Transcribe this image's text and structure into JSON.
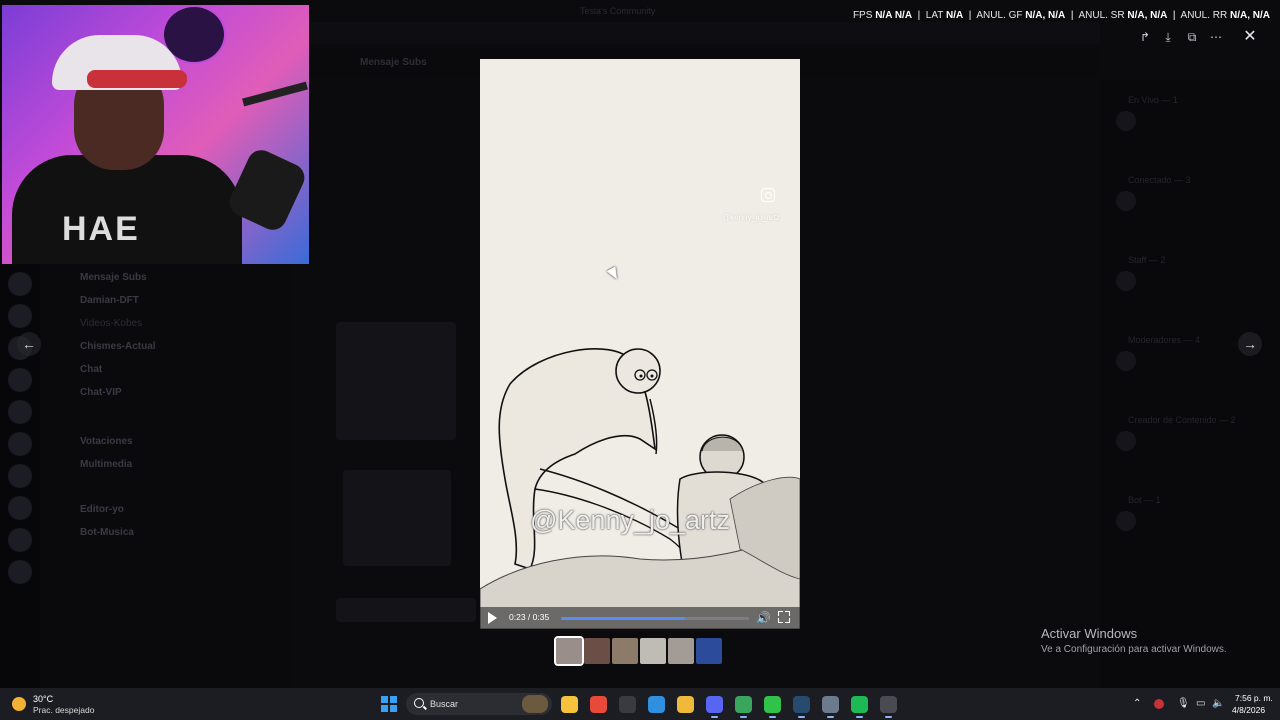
{
  "bg": {
    "window_title": "Tesla's Community",
    "channel_title": "Mensaje Subs",
    "channels": [
      {
        "label": "Mensaje Subs",
        "bright": true
      },
      {
        "label": "Damian-DFT",
        "bright": true
      },
      {
        "label": "Videos-Kobes",
        "bright": false
      },
      {
        "label": "Chismes-Actual",
        "bright": true
      },
      {
        "label": "Chat",
        "bright": true
      },
      {
        "label": "Chat-VIP",
        "bright": true
      },
      {
        "label": "Votaciones",
        "bright": true
      },
      {
        "label": "Multimedia",
        "bright": true
      },
      {
        "label": "Editor-yo",
        "bright": true
      },
      {
        "label": "Bot-Musica",
        "bright": true
      }
    ],
    "members": [
      "En Vivo — 1",
      "Conectado — 3",
      "Staff — 2",
      "Moderadores — 4",
      "Creador de Contenido — 2",
      "Bot — 1"
    ]
  },
  "stats": {
    "fps_label": "FPS",
    "fps_value": "N/A N/A",
    "lat_label": "LAT",
    "lat_value": "N/A",
    "gf_label": "ANUL. GF",
    "gf_value": "N/A, N/A",
    "sr_label": "ANUL. SR",
    "sr_value": "N/A, N/A",
    "rr_label": "ANUL. RR",
    "rr_value": "N/A, N/A"
  },
  "viewer": {
    "instagram_handle": "@kenny_jo_artz",
    "watermark": "@Kenny_jo_artz",
    "time": "0:23 / 0:35",
    "progress": 0.66,
    "thumb_colors": [
      "#9a8e8a",
      "#6b4f47",
      "#8c7b68",
      "#bfbcb5",
      "#a39c96",
      "#2c4b9a"
    ]
  },
  "activate": {
    "title": "Activar Windows",
    "subtitle": "Ve a Configuración para activar Windows."
  },
  "taskbar": {
    "temp": "30°C",
    "weather": "Prac. despejado",
    "search_label": "Buscar",
    "time": "7:56 p. m.",
    "date": "4/8/2026",
    "apps": [
      {
        "name": "file-explorer-icon",
        "color": "#f5c23c",
        "on": false
      },
      {
        "name": "chrome-icon",
        "color": "#e84a3a",
        "on": false
      },
      {
        "name": "app-icon",
        "color": "#3a3a40",
        "on": false
      },
      {
        "name": "photos-icon",
        "color": "#2f8fe0",
        "on": false
      },
      {
        "name": "folder-icon",
        "color": "#f0b93a",
        "on": false
      },
      {
        "name": "discord-icon",
        "color": "#5865f2",
        "on": true
      },
      {
        "name": "chrome-alt-icon",
        "color": "#3aa55c",
        "on": true
      },
      {
        "name": "greenapp-icon",
        "color": "#31c24a",
        "on": true
      },
      {
        "name": "steam-icon",
        "color": "#274b6e",
        "on": true
      },
      {
        "name": "settings-icon",
        "color": "#6b7a8c",
        "on": true
      },
      {
        "name": "spotify-icon",
        "color": "#1db954",
        "on": true
      },
      {
        "name": "obs-icon",
        "color": "#4a4a52",
        "on": true
      }
    ]
  }
}
